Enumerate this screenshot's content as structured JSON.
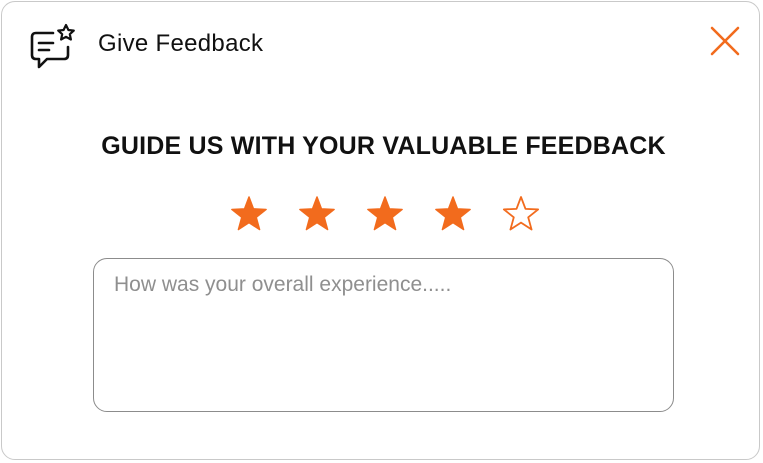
{
  "header": {
    "title": "Give Feedback",
    "icon": "feedback-chat-star-icon",
    "close_icon": "close-icon"
  },
  "main": {
    "heading": "GUIDE US WITH YOUR VALUABLE FEEDBACK",
    "rating": {
      "value": 4,
      "max": 5,
      "filled_icon": "star-filled-icon",
      "empty_icon": "star-outline-icon"
    },
    "feedback_input": {
      "value": "",
      "placeholder": "How was your overall experience....."
    }
  },
  "colors": {
    "accent": "#f26b1d",
    "text": "#111111",
    "border": "#c9c9c9",
    "placeholder": "#8f8f8f"
  }
}
